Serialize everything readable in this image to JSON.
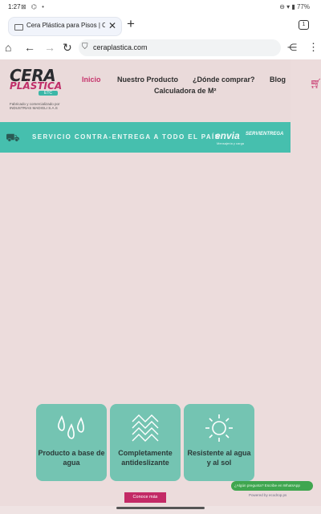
{
  "status_bar": {
    "time": "1:27",
    "indicators": "⊠ ⌬ •",
    "right": "⊖ ▾ ▮ 77%"
  },
  "browser": {
    "tab": {
      "title": "Cera Plástica para Pisos | Colo"
    },
    "new_tab": "+",
    "tab_count": "1",
    "url": "ceraplastica.com"
  },
  "site": {
    "logo": {
      "line1": "CERA",
      "line2": "PLÁSTICA",
      "badge": "ETC",
      "sub": "Fabricado y comercializado por INDUSTRIAS MADIGLI S.A.S"
    },
    "nav": [
      {
        "label": "Inicio",
        "active": true
      },
      {
        "label": "Nuestro Producto"
      },
      {
        "label": "¿Dónde comprar?"
      },
      {
        "label": "Blog"
      },
      {
        "label": "Calculadora de M²"
      }
    ],
    "banner": {
      "text": "SERVICIO CONTRA-ENTREGA A TODO EL PAÍS",
      "carrier1": "envia",
      "carrier1_sub": "Mensajería y carga",
      "carrier2": "SERVIENTREGA"
    },
    "features": [
      {
        "label": "Producto a base de agua",
        "icon": "water-drops-icon"
      },
      {
        "label": "Completamente antideslizante",
        "icon": "grid-pattern-icon"
      },
      {
        "label": "Resistente al agua y al sol",
        "icon": "sun-icon"
      }
    ],
    "cta": "Conoce más",
    "whatsapp": "¿Algún pregunta? Escribe en WhatsApp",
    "whatsapp_sub": "Powered by ecodrop.ps"
  },
  "colors": {
    "accent": "#c6336b",
    "teal": "#46bfae",
    "card": "#74c4b2"
  }
}
